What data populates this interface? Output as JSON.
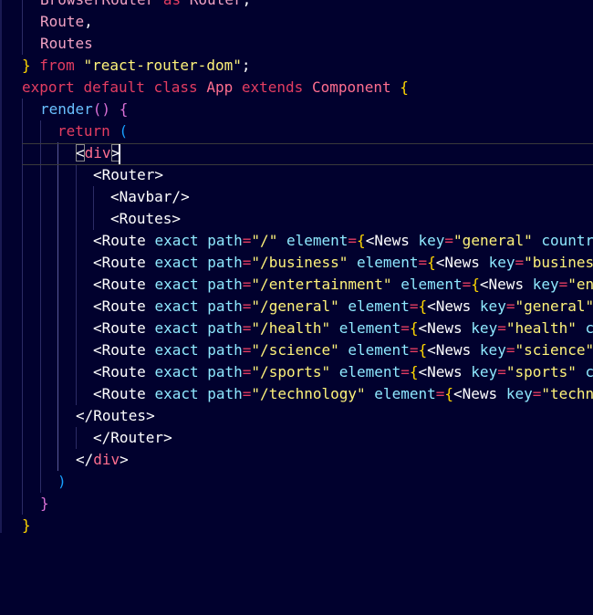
{
  "editor": {
    "language": "javascript-react",
    "theme_colors": {
      "background": "#01012e",
      "keyword": "#e43d61",
      "string": "#fff37a",
      "attribute": "#8fe9ff",
      "function": "#6ac0ff",
      "identifier": "#f2a2c3",
      "bracket_gold": "#ffd700",
      "bracket_purple": "#da70d6",
      "bracket_blue": "#179fff"
    },
    "code": {
      "l0": {
        "t0": "BrowserRouter",
        "t1": "as",
        "t2": "Router",
        "t3": ","
      },
      "l1": {
        "t0": "Route",
        "t1": ","
      },
      "l2": {
        "t0": "Routes"
      },
      "l3": {
        "t0": "}",
        "t1": "from",
        "t2": "\"react-router-dom\"",
        "t3": ";"
      },
      "l4": {
        "t0": "export",
        "t1": "default",
        "t2": "class",
        "t3": "App",
        "t4": "extends",
        "t5": "Component",
        "t6": "{"
      },
      "l5": {
        "t0": "render",
        "t1": "()",
        "t2": "{"
      },
      "l6": {
        "t0": "return",
        "t1": "("
      },
      "l7": {
        "t0": "<",
        "t1": "div",
        "t2": ">"
      },
      "l8": {
        "t0": "<Router>"
      },
      "l9": {
        "t0": "<Navbar/>"
      },
      "l10": {
        "t0": "<Routes>"
      },
      "routes": [
        {
          "path": "\"/\"",
          "key": "\"general\"",
          "tail": " countr"
        },
        {
          "path": "\"/business\"",
          "key": "\"busines",
          "tail": ""
        },
        {
          "path": "\"/entertainment\"",
          "key": "\"en",
          "tail": ""
        },
        {
          "path": "\"/general\"",
          "key": "\"general\"",
          "tail": ""
        },
        {
          "path": "\"/health\"",
          "key": "\"health\"",
          "tail": " c"
        },
        {
          "path": "\"/science\"",
          "key": "\"science\"",
          "tail": ""
        },
        {
          "path": "\"/sports\"",
          "key": "\"sports\"",
          "tail": " c"
        },
        {
          "path": "\"/technology\"",
          "key": "\"techn",
          "tail": ""
        }
      ],
      "route_tokens": {
        "open": "<Route",
        "exact": "exact",
        "path_attr": "path",
        "eq": "=",
        "element_attr": "element",
        "brace": "{",
        "news_open": "<News",
        "key_attr": "key"
      },
      "l19": {
        "t0": "</Routes>"
      },
      "l20": {
        "t0": "</Router>"
      },
      "l21": {
        "t0": "</",
        "t1": "div",
        "t2": ">"
      },
      "l22": {
        "t0": ")"
      },
      "l23": {
        "t0": "}"
      },
      "l24": {
        "t0": "}"
      }
    }
  }
}
